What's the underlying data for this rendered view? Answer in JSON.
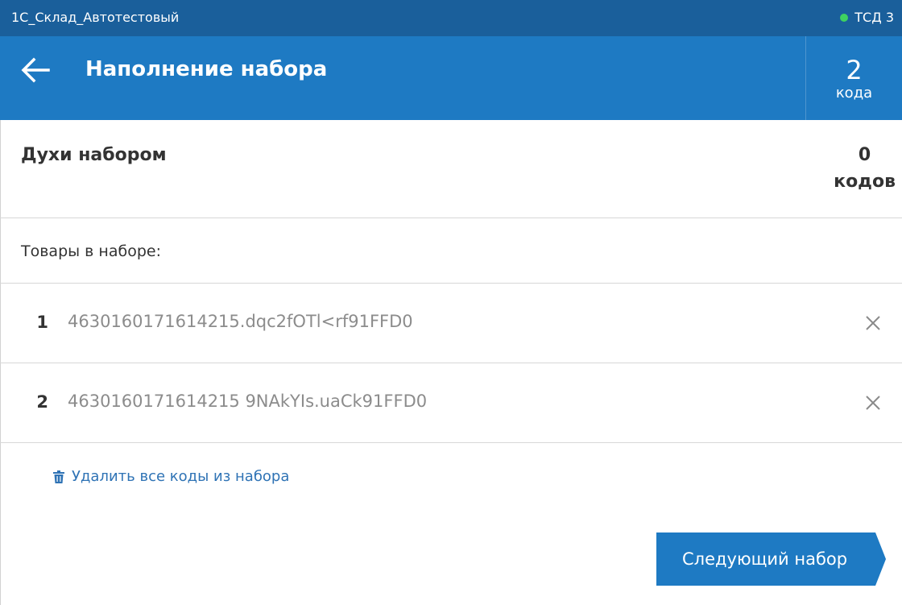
{
  "topbar": {
    "app_title": "1С_Склад_Автотестовый",
    "device_label": "ТСД 3",
    "status_color": "#3ed160"
  },
  "header": {
    "title": "Наполнение набора",
    "back_icon": "arrow-left-icon",
    "counter_value": "2",
    "counter_unit": "кода"
  },
  "product": {
    "name": "Духи набором",
    "count_value": "0",
    "count_unit": "кодов"
  },
  "section": {
    "label": "Товары в наборе:"
  },
  "codes": [
    {
      "index": "1",
      "code": "4630160171614215.dqc2fOTl<rf91FFD0",
      "remove_icon": "close-icon"
    },
    {
      "index": "2",
      "code": "4630160171614215 9NAkYIs.uaCk91FFD0"
    }
  ],
  "actions": {
    "clear_label": "Удалить все коды из набора",
    "clear_icon": "trash-icon",
    "next_label": "Следующий набор"
  },
  "colors": {
    "topbar": "#1a5f9b",
    "header": "#1e7ac3",
    "link": "#2f73b5"
  }
}
